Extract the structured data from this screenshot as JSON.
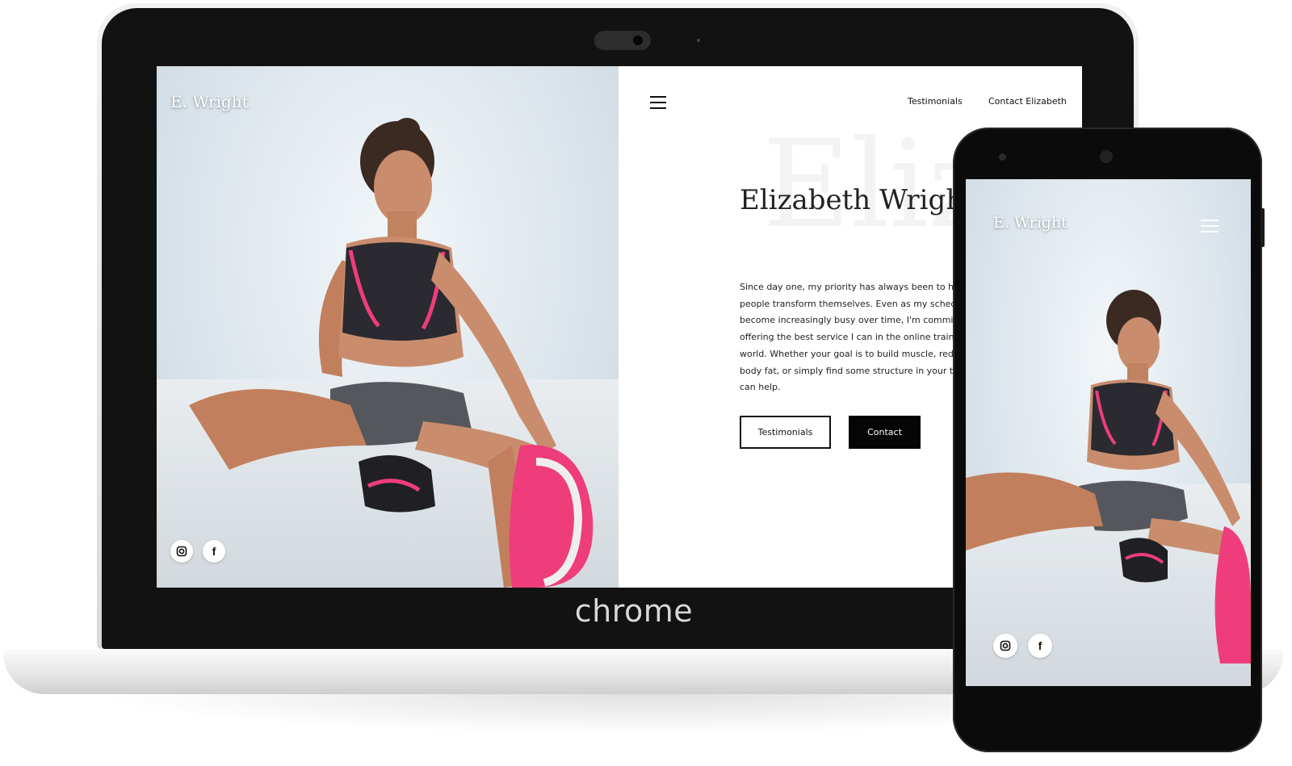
{
  "laptop": {
    "brand_label": "chrome",
    "site": {
      "logo": "E. Wright",
      "nav": [
        "Testimonials",
        "Contact Elizabeth"
      ],
      "background_word": "Eliz",
      "title": "Elizabeth Wright",
      "body_lines": [
        "Since day one, my priority has always been to he",
        "people transform themselves. Even as my sched",
        "become increasingly busy over time, I'm commit",
        "offering the best service I can in the online traini",
        "world. Whether your goal is to build muscle, redu",
        "body fat, or simply find some structure in your tra",
        "can help."
      ],
      "buttons": {
        "testimonials": "Testimonials",
        "contact": "Contact"
      },
      "social": {
        "instagram_icon": "instagram-icon",
        "facebook_icon": "f"
      }
    }
  },
  "phone": {
    "site": {
      "logo": "E. Wright",
      "social": {
        "instagram_icon": "instagram-icon",
        "facebook_icon": "f"
      }
    }
  },
  "colors": {
    "accent_pink": "#ee3d7a",
    "dark": "#111111",
    "button_solid": "#050505"
  }
}
